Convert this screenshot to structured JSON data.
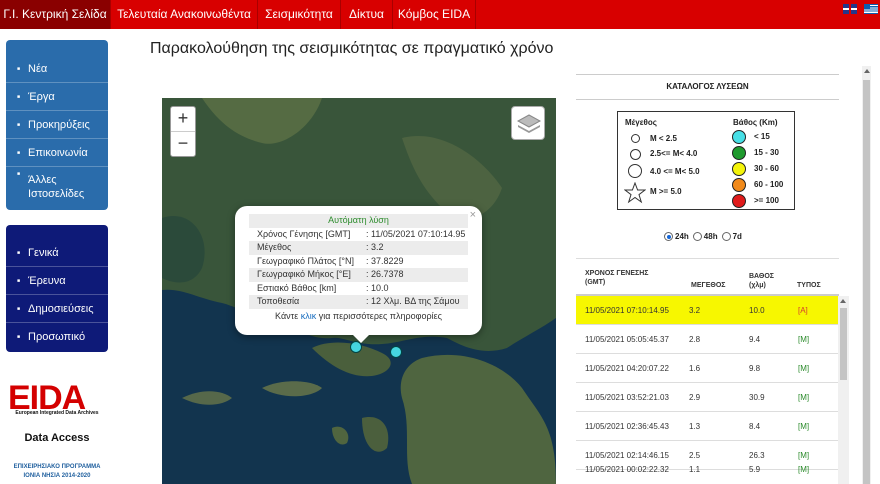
{
  "nav": {
    "tabs": [
      {
        "label": "Γ.Ι. Κεντρική Σελίδα"
      },
      {
        "label": "Τελευταία Ανακοινωθέντα"
      },
      {
        "label": "Σεισμικότητα"
      },
      {
        "label": "Δίκτυα"
      },
      {
        "label": "Κόμβος EIDA"
      }
    ]
  },
  "sidebar": {
    "group1": [
      "Νέα",
      "Έργα",
      "Προκηρύξεις",
      "Επικοινωνία",
      "Άλλες Ιστοσελίδες"
    ],
    "group2": [
      "Γενικά",
      "Έρευνα",
      "Δημοσιεύσεις",
      "Προσωπικό"
    ],
    "logo_text": "EIDA",
    "logo_sub": "European Integrated Data Archives",
    "data_access": "Data Access",
    "program_1": "ΕΠΙΧΕΙΡΗΣΙΑΚΟ ΠΡΟΓΡΑΜΜΑ",
    "program_2": "ΙΟΝΙΑ ΝΗΣΙΑ 2014-2020"
  },
  "page_title": "Παρακολούθηση της σεισμικότητας σε πραγματικό χρόνο",
  "map": {
    "zoom_in": "+",
    "zoom_out": "−",
    "popup": {
      "close": "×",
      "title": "Αυτόματη λύση",
      "rows": [
        {
          "k": "Χρόνος Γένησης [GMT]",
          "v": ": 11/05/2021 07:10:14.95"
        },
        {
          "k": "Μέγεθος",
          "v": ": 3.2"
        },
        {
          "k": "Γεωγραφικό Πλάτος [°N]",
          "v": ": 37.8229"
        },
        {
          "k": "Γεωγραφικό Μήκος [°E]",
          "v": ": 26.7378"
        },
        {
          "k": "Εστιακό Βάθος [km]",
          "v": ": 10.0"
        },
        {
          "k": "Τοποθεσία",
          "v": ": 12 Χλμ. ΒΔ της Σάμου"
        }
      ],
      "more_pre": "Κάντε ",
      "more_link": "κλικ",
      "more_post": " για περισσότερες πληροφορίες"
    }
  },
  "catalog": {
    "title": "ΚΑΤΑΛΟΓΟΣ ΛΥΣΕΩΝ",
    "legend": {
      "mag_header": "Μέγεθος",
      "depth_header": "Βάθος (Km)",
      "mag": [
        "M < 2.5",
        "2.5<= M< 4.0",
        "4.0 <= M< 5.0",
        "M >= 5.0"
      ],
      "depth": [
        {
          "label": "< 15",
          "color": "#47dfe6"
        },
        {
          "label": "15 - 30",
          "color": "#1f9a2e"
        },
        {
          "label": "30 - 60",
          "color": "#f4f40a"
        },
        {
          "label": "60 - 100",
          "color": "#f18a1b"
        },
        {
          "label": ">= 100",
          "color": "#e01b1b"
        }
      ]
    },
    "periods": [
      {
        "label": "24h",
        "selected": true
      },
      {
        "label": "48h",
        "selected": false
      },
      {
        "label": "7d",
        "selected": false
      }
    ],
    "headers": {
      "time": "ΧΡΟΝΟΣ ΓΕΝΕΣΗΣ (GMT)",
      "mag": "ΜΕΓΕΘΟΣ",
      "depth": "ΒΑΘΟΣ (χλμ)",
      "type": "ΤΥΠΟΣ"
    },
    "rows": [
      {
        "time": "11/05/2021 07:10:14.95",
        "mag": "3.2",
        "depth": "10.0",
        "type": "[A]"
      },
      {
        "time": "11/05/2021 05:05:45.37",
        "mag": "2.8",
        "depth": "9.4",
        "type": "[M]"
      },
      {
        "time": "11/05/2021 04:20:07.22",
        "mag": "1.6",
        "depth": "9.8",
        "type": "[M]"
      },
      {
        "time": "11/05/2021 03:52:21.03",
        "mag": "2.9",
        "depth": "30.9",
        "type": "[M]"
      },
      {
        "time": "11/05/2021 02:36:45.43",
        "mag": "1.3",
        "depth": "8.4",
        "type": "[M]"
      },
      {
        "time": "11/05/2021 02:14:46.15",
        "mag": "2.5",
        "depth": "26.3",
        "type": "[M]"
      },
      {
        "time": "11/05/2021 00:02:22.32",
        "mag": "1.1",
        "depth": "5.9",
        "type": "[M]"
      }
    ]
  }
}
